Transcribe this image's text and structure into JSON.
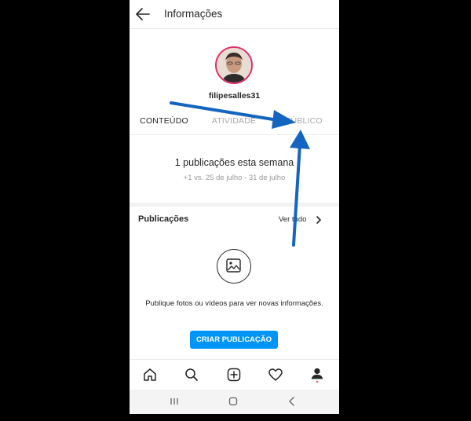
{
  "header": {
    "title": "Informações",
    "back_icon": "arrow-left-icon"
  },
  "profile": {
    "username": "filipesalles31"
  },
  "tabs": [
    {
      "label": "CONTEÚDO",
      "active": true
    },
    {
      "label": "ATIVIDADE",
      "active": false
    },
    {
      "label": "PÚBLICO",
      "active": false
    }
  ],
  "summary": {
    "main": "1 publicações esta semana",
    "sub": "+1 vs. 25 de julho - 31 de julho"
  },
  "publications": {
    "title": "Publicações",
    "see_all": "Ver tudo",
    "empty_text": "Publique fotos ou vídeos para ver novas informações.",
    "create_button": "CRIAR PUBLICAÇÃO"
  },
  "bottom_nav": [
    "home-icon",
    "search-icon",
    "add-post-icon",
    "heart-icon",
    "profile-icon"
  ],
  "system_nav": [
    "recent-apps-icon",
    "home-circle-icon",
    "back-icon"
  ],
  "colors": {
    "accent": "#0095f6",
    "avatar_ring": "#e1306c",
    "annotation_arrow": "#1565c0"
  }
}
